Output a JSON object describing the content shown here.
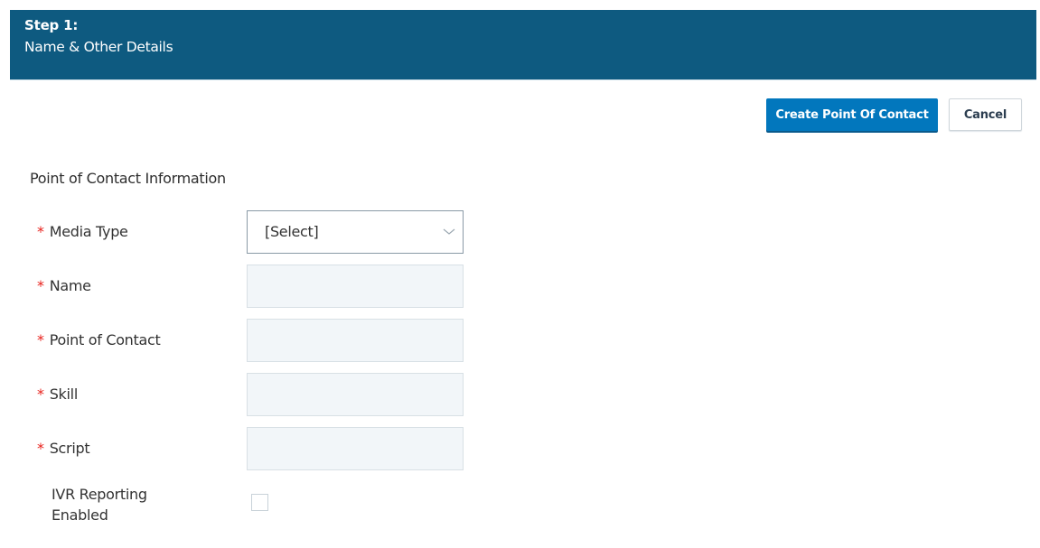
{
  "header": {
    "step": "Step 1:",
    "subtitle": "Name & Other Details"
  },
  "actions": {
    "create_label": "Create Point Of Contact",
    "cancel_label": "Cancel"
  },
  "section": {
    "title": "Point of Contact Information"
  },
  "fields": [
    {
      "label": "Media Type",
      "required": "*",
      "type": "select",
      "value": "[Select]"
    },
    {
      "label": "Name",
      "required": "*",
      "type": "text",
      "value": ""
    },
    {
      "label": "Point of Contact",
      "required": "*",
      "type": "text",
      "value": ""
    },
    {
      "label": "Skill",
      "required": "*",
      "type": "text",
      "value": ""
    },
    {
      "label": "Script",
      "required": "*",
      "type": "text",
      "value": ""
    }
  ],
  "ivr": {
    "label_line1": "IVR Reporting",
    "label_line2": "Enabled",
    "checked": false
  },
  "colors": {
    "header_bg": "#0e5a80",
    "primary_button": "#0277bd",
    "required_asterisk": "#e8201a"
  }
}
